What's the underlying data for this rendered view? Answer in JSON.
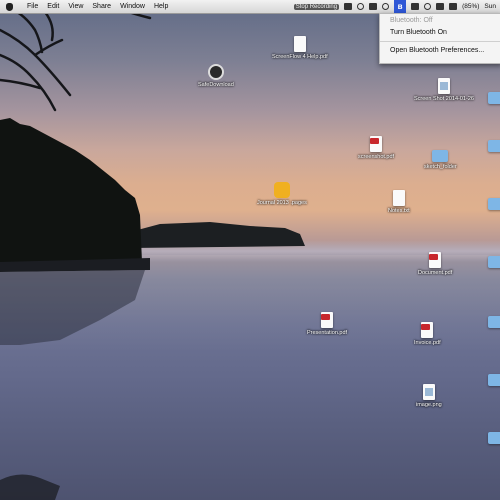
{
  "menubar": {
    "menus": [
      "File",
      "Edit",
      "View",
      "Share",
      "Window",
      "Help"
    ],
    "recording": "Stop Recording",
    "battery": "(85%)",
    "clock": "Sun"
  },
  "bluetooth_menu": {
    "status": "Bluetooth: Off",
    "turn_on": "Turn Bluetooth On",
    "preferences": "Open Bluetooth Preferences..."
  },
  "desktop_icons": [
    {
      "label": "ScreenFlow 4 Help.pdf"
    },
    {
      "label": "SafeDownload"
    },
    {
      "label": "Screen Shot 2014-01-26"
    },
    {
      "label": "screenshot.pdf"
    },
    {
      "label": "sketch_folder"
    },
    {
      "label": "Journal 2013 .pages"
    },
    {
      "label": "Notes.txt"
    },
    {
      "label": "Document.pdf"
    },
    {
      "label": "Presentation.pdf"
    },
    {
      "label": "Invoice.pdf"
    },
    {
      "label": "image.png"
    }
  ]
}
